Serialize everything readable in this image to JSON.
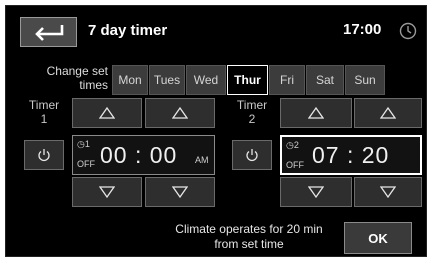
{
  "header": {
    "title": "7 day timer",
    "clock": "17:00",
    "back_icon": "return-arrow-icon",
    "clock_icon": "clock-icon"
  },
  "days": {
    "label_line1": "Change set",
    "label_line2": "times",
    "items": [
      "Mon",
      "Tues",
      "Wed",
      "Thur",
      "Fri",
      "Sat",
      "Sun"
    ],
    "selected": "Thur"
  },
  "timer1": {
    "label_line1": "Timer",
    "label_line2": "1",
    "badge_number": "1",
    "state": "OFF",
    "hours": "00",
    "minutes": "00",
    "separator": ":",
    "ampm": "AM"
  },
  "timer2": {
    "label_line1": "Timer",
    "label_line2": "2",
    "badge_number": "2",
    "state": "OFF",
    "hours": "07",
    "minutes": "20",
    "separator": ":"
  },
  "footer": {
    "info_line1": "Climate operates for 20 min",
    "info_line2": "from set time",
    "ok_label": "OK"
  },
  "colors": {
    "background": "#000000",
    "button": "#3a3a3a",
    "selected_border": "#ffffff",
    "text": "#ffffff"
  }
}
